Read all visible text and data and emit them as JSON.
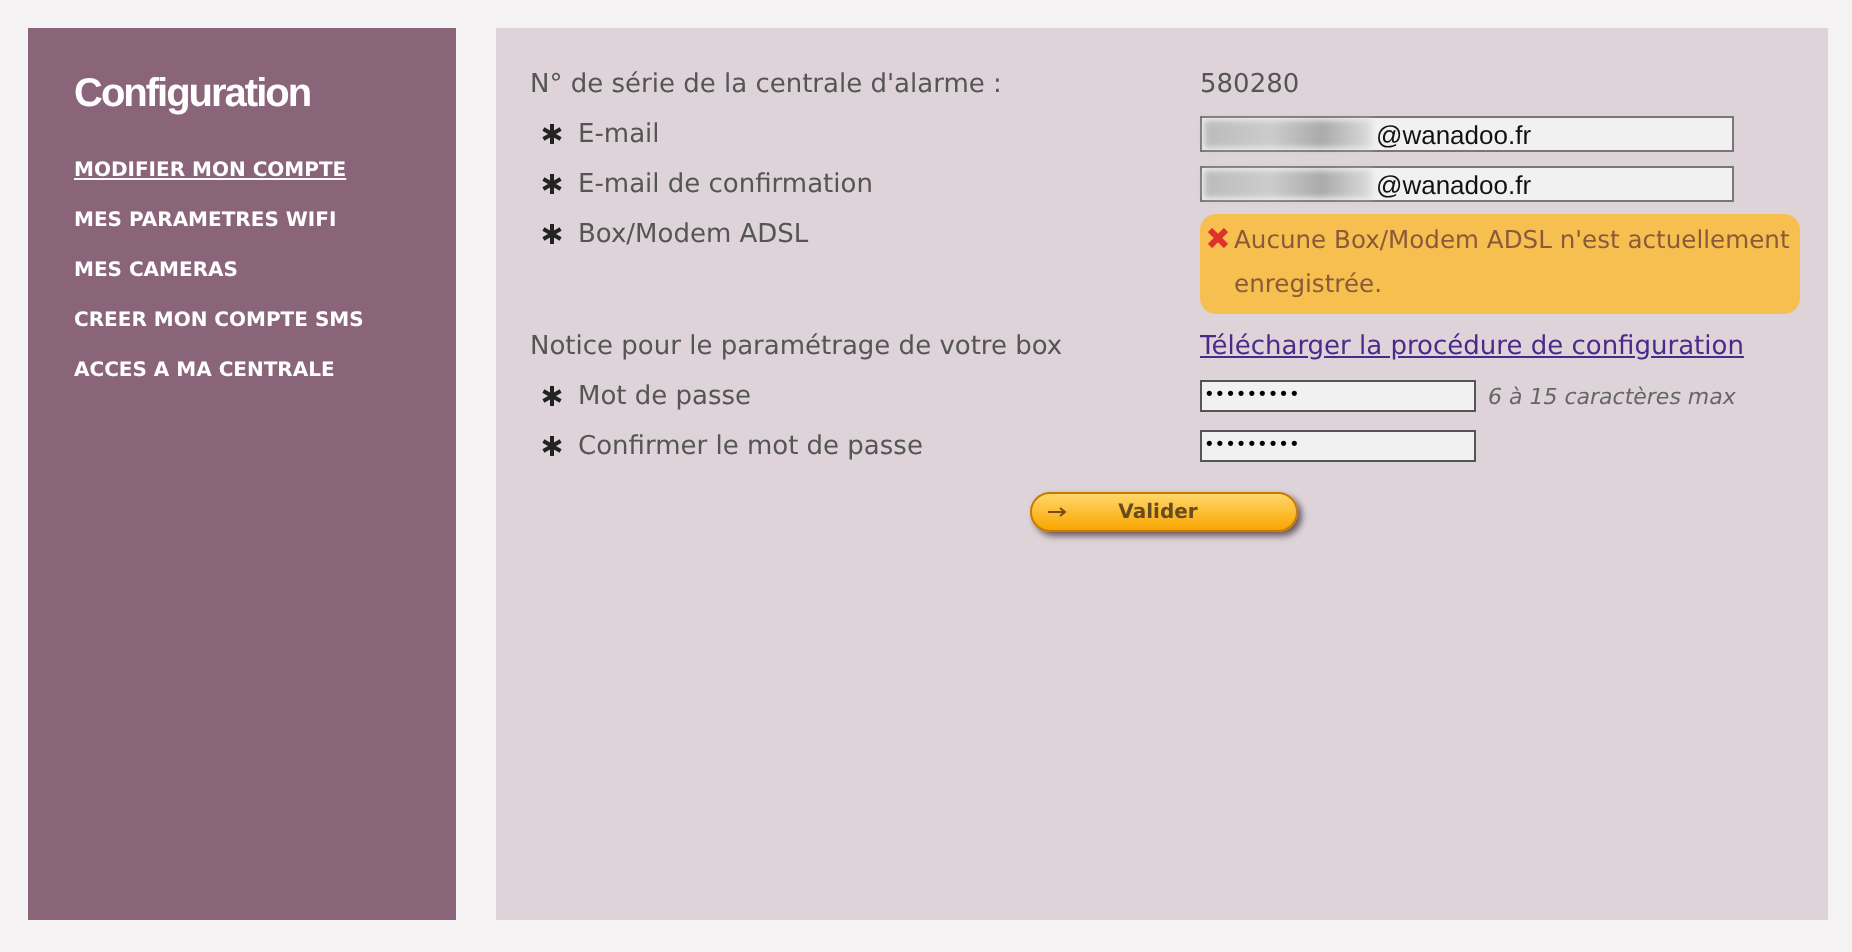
{
  "sidebar": {
    "title": "Configuration",
    "items": [
      {
        "label": "MODIFIER MON COMPTE",
        "selected": true
      },
      {
        "label": "MES PARAMETRES WIFI",
        "selected": false
      },
      {
        "label": "MES CAMERAS",
        "selected": false
      },
      {
        "label": "CREER MON COMPTE SMS",
        "selected": false
      },
      {
        "label": "ACCES A MA CENTRALE",
        "selected": false
      }
    ]
  },
  "form": {
    "rows": [
      {
        "kind": "info",
        "required": false,
        "label": "N° de série de la centrale d'alarme :",
        "value": "580280"
      },
      {
        "kind": "email",
        "required": true,
        "label": "E-mail",
        "value": "@wanadoo.fr"
      },
      {
        "kind": "email",
        "required": true,
        "label": "E-mail de confirmation",
        "value": "@wanadoo.fr"
      },
      {
        "kind": "alert",
        "required": true,
        "label": "Box/Modem ADSL",
        "message": "Aucune Box/Modem ADSL n'est actuellement enregistrée."
      },
      {
        "kind": "link",
        "required": false,
        "label": "Notice pour le paramétrage de votre box",
        "link": "Télécharger la procédure de configuration"
      },
      {
        "kind": "password",
        "required": true,
        "label": "Mot de passe",
        "value": "•••••••••",
        "hint": "6 à 15 caractères max"
      },
      {
        "kind": "password",
        "required": true,
        "label": "Confirmer le mot de passe",
        "value": "•••••••••"
      }
    ],
    "submit": "Valider"
  }
}
